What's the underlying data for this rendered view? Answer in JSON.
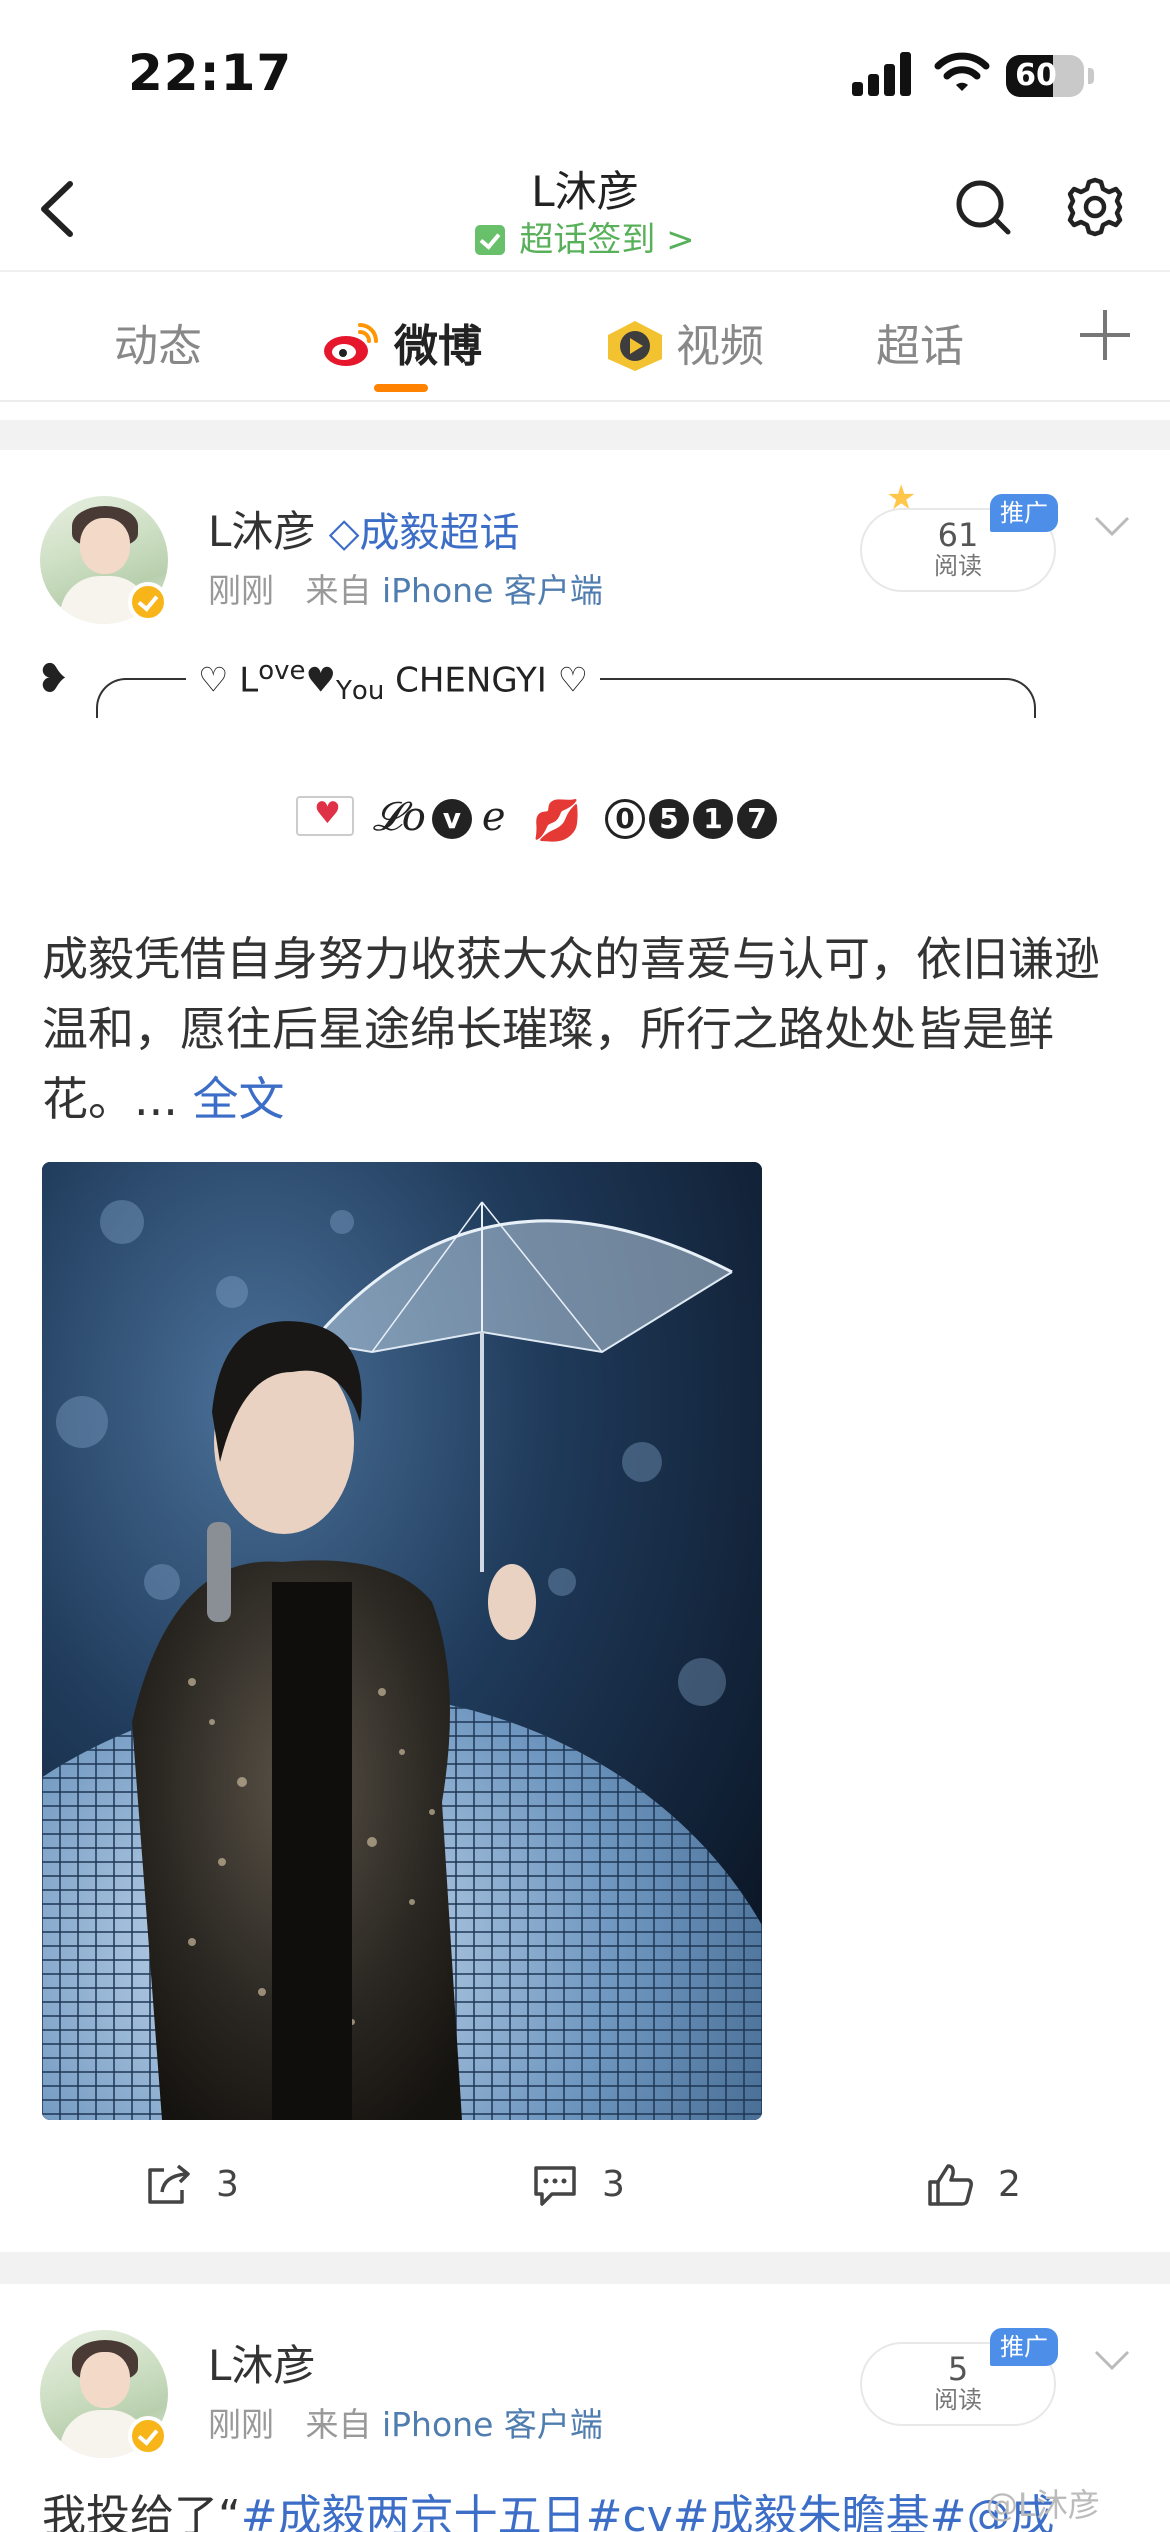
{
  "status_bar": {
    "time": "22:17",
    "battery": "60",
    "battery_level": 0.6
  },
  "nav": {
    "title": "L沐彦",
    "subtitle": "超话签到",
    "subtitle_arrow": ">"
  },
  "tabs": [
    {
      "label": "动态"
    },
    {
      "label": "微博"
    },
    {
      "label": "视频"
    },
    {
      "label": "超话"
    }
  ],
  "posts": [
    {
      "author": "L沐彦",
      "topic": "成毅超话",
      "time": "刚刚",
      "from_prefix": "来自",
      "source": "iPhone 客户端",
      "reads": "61",
      "reads_label": "阅读",
      "promo": "推广",
      "deco_text_love": "ove",
      "deco_text_you_y": "Y",
      "deco_text_you_ou": "ou",
      "deco_text_name": "CHENGYI",
      "deco_L": "L",
      "love_script_1": "𝓛o",
      "love_circle": "v",
      "love_script_2": "e",
      "digits": [
        "0",
        "5",
        "1",
        "7"
      ],
      "body": "成毅凭借自身努力收获大众的喜爱与认可，依旧谦逊温和，愿往后星途绵长璀璨，所行之路处处皆是鲜花。...",
      "more": "全文",
      "actions": {
        "share": "3",
        "comment": "3",
        "like": "2"
      }
    },
    {
      "author": "L沐彦",
      "time": "刚刚",
      "from_prefix": "来自",
      "source": "iPhone 客户端",
      "reads": "5",
      "reads_label": "阅读",
      "promo": "推广",
      "body_prefix": "我投给了“",
      "body_tags": "#成毅两京十五日#cv#成毅朱瞻基#@成",
      "watermark": "@L沐彦"
    }
  ],
  "colors": {
    "accent_orange": "#ff8200",
    "link_blue": "#3c6ec8",
    "checkin_green": "#58b15a",
    "promo_blue": "#4d8ee8",
    "verified_gold": "#f8b51a"
  },
  "icons": [
    "back-icon",
    "search-icon",
    "gear-icon",
    "weibo-logo-icon",
    "video-logo-icon",
    "plus-icon",
    "share-icon",
    "comment-icon",
    "like-icon",
    "chevron-down-icon"
  ]
}
